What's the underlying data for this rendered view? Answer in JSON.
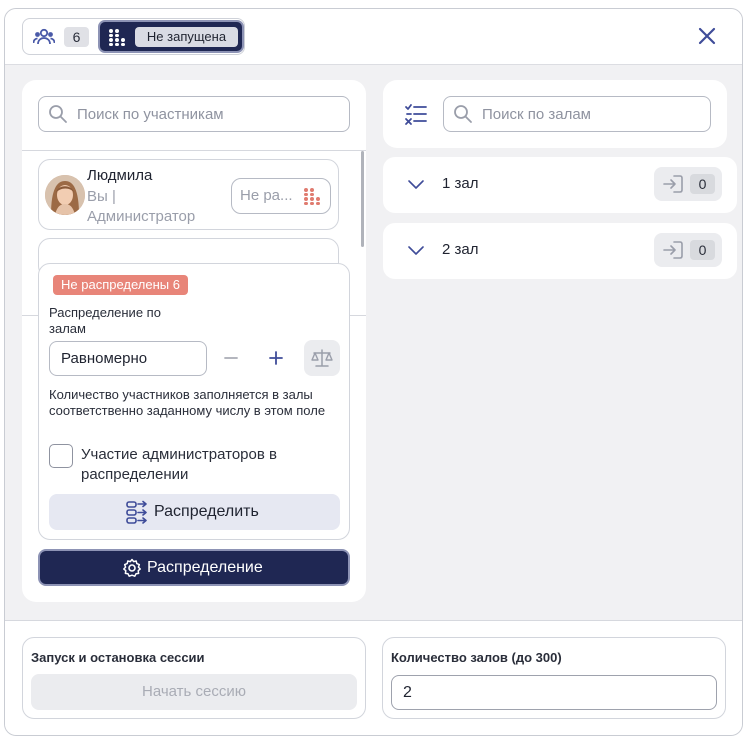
{
  "topbar": {
    "participants_count": "6",
    "status_label": "Не запущена"
  },
  "left": {
    "search_placeholder": "Поиск по участникам",
    "participant": {
      "name": "Людмила",
      "role_line1": "Вы |",
      "role_line2": "Администратор",
      "room_placeholder": "Не ра..."
    },
    "distribution": {
      "unassigned_badge": "Не распределены 6",
      "label": "Распределение по залам",
      "mode_value": "Равномерно",
      "hint": "Количество участников заполняется в залы соответственно заданному числу в этом поле",
      "admins_checkbox_label": "Участие администраторов в распределении",
      "admins_checked": false,
      "distribute_button": "Распределить"
    },
    "settings_button": "Распределение"
  },
  "right": {
    "search_placeholder": "Поиск по залам",
    "rooms": [
      {
        "name": "1 зал",
        "count": "0"
      },
      {
        "name": "2 зал",
        "count": "0"
      }
    ]
  },
  "bottom": {
    "session_title": "Запуск и остановка сессии",
    "start_button": "Начать сессию",
    "rooms_count_title": "Количество залов (до 300)",
    "rooms_count_value": "2"
  },
  "colors": {
    "primary": "#1f2753",
    "badge_red": "#e88579",
    "icon_blue": "#4a5aa8",
    "group_icon_red": "#e07b6f"
  },
  "icons": [
    "people-icon",
    "group-icon",
    "close-icon",
    "search-icon",
    "sort-icon",
    "chevron-down-icon",
    "enter-room-icon",
    "minus-icon",
    "plus-icon",
    "balance-icon",
    "distribute-icon",
    "gear-icon"
  ]
}
